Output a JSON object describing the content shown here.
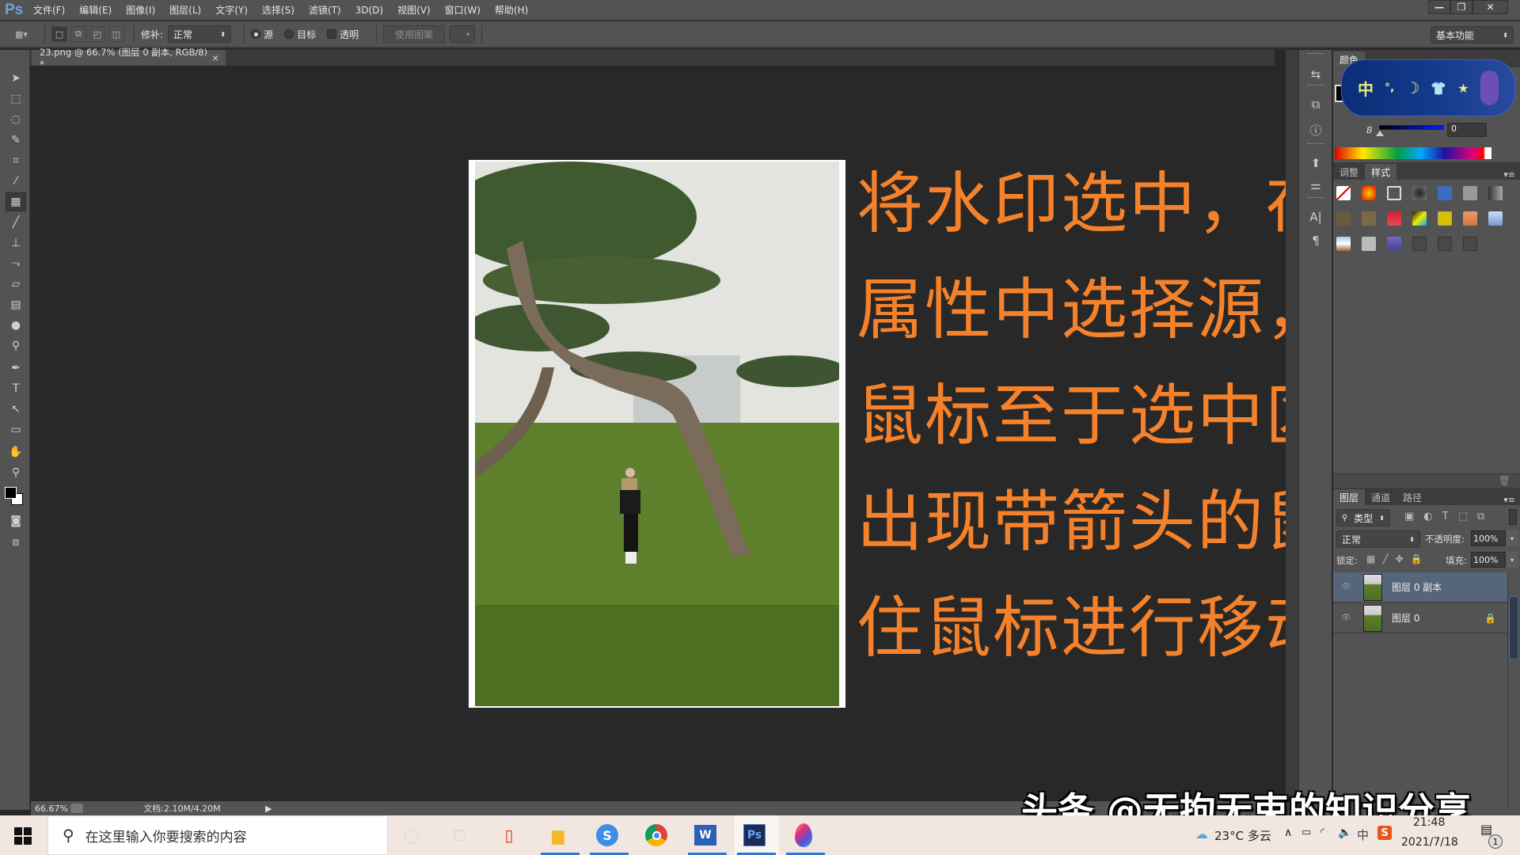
{
  "app": {
    "logo": "Ps",
    "menu": [
      "文件(F)",
      "编辑(E)",
      "图像(I)",
      "图层(L)",
      "文字(Y)",
      "选择(S)",
      "滤镜(T)",
      "3D(D)",
      "视图(V)",
      "窗口(W)",
      "帮助(H)"
    ],
    "window_controls": {
      "minimize": "—",
      "restore": "❐",
      "close": "✕"
    }
  },
  "options_bar": {
    "patch_label": "修补:",
    "patch_mode": "正常",
    "source_label": "源",
    "source_selected": true,
    "target_label": "目标",
    "transparent_label": "透明",
    "transparent_checked": false,
    "use_pattern_label": "使用图案",
    "workspace": "基本功能"
  },
  "document": {
    "tab_title": "23.png @ 66.7% (图层 0 副本, RGB/8) *",
    "tab_close": "×"
  },
  "overlay_text": {
    "lines": [
      "将水印选中，在工具栏",
      "属性中选择源，之后将",
      "鼠标至于选中区域上会",
      "出现带箭头的鼠标，按",
      "住鼠标进行移动即可。"
    ],
    "color": "#f5822a"
  },
  "status_bar": {
    "zoom": "66.67%",
    "doc_info": "文档:2.10M/4.20M",
    "arrow": "▶"
  },
  "color_panel": {
    "tab": "颜色",
    "b_label": "B",
    "b_value": "0"
  },
  "ime_skin": {
    "glyphs": [
      "中",
      "°,",
      "☽",
      "👕",
      "★"
    ]
  },
  "styles_panel": {
    "tabs": [
      "调整",
      "样式"
    ],
    "active_tab": "样式"
  },
  "layers_panel": {
    "tabs": [
      "图层",
      "通道",
      "路径"
    ],
    "active_tab": "图层",
    "filter": "类型",
    "blend_mode": "正常",
    "opacity_label": "不透明度:",
    "opacity": "100%",
    "lock_label": "锁定:",
    "fill_label": "填充:",
    "fill": "100%",
    "layers": [
      {
        "name": "图层 0 副本",
        "selected": true,
        "locked": false
      },
      {
        "name": "图层 0",
        "selected": false,
        "locked": true
      }
    ]
  },
  "taskbar": {
    "search_placeholder": "在这里输入你要搜索的内容",
    "apps": [
      "cortana",
      "task-view",
      "office",
      "file-explorer",
      "sogou-browser",
      "chrome",
      "word",
      "photoshop",
      "paint"
    ],
    "weather": "23°C 多云",
    "ime": "中",
    "time": "21:48",
    "date": "2021/7/18",
    "notification_count": "1"
  },
  "watermark": "头条 @无拘无束的知识分享"
}
